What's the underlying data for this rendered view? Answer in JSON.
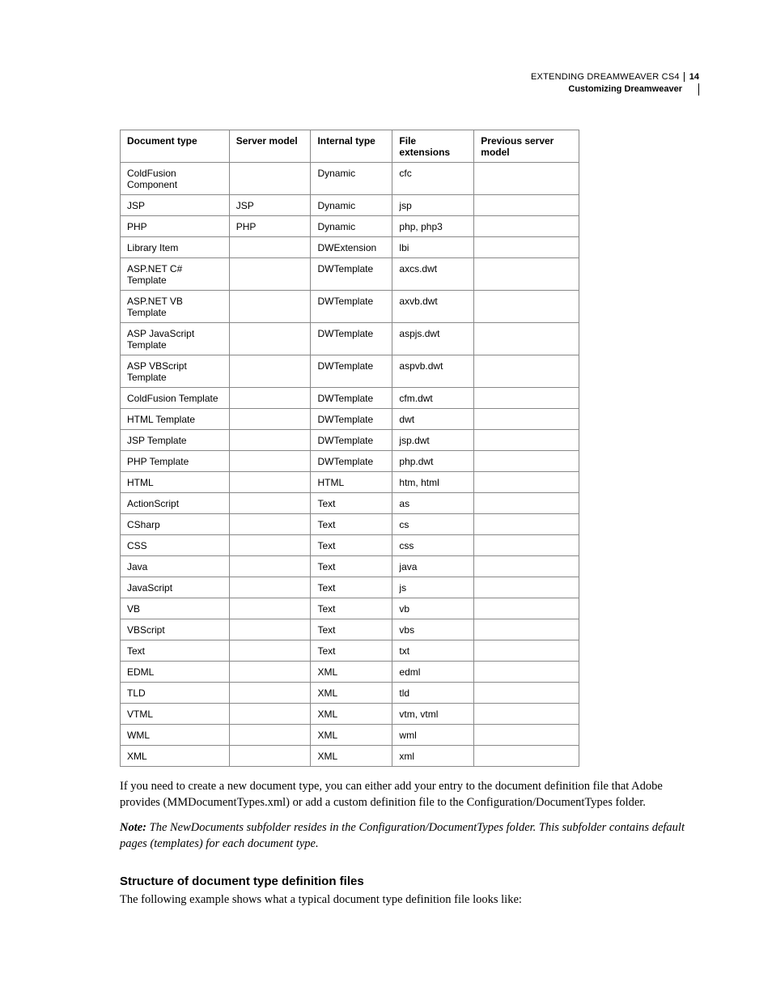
{
  "header": {
    "line1": "EXTENDING DREAMWEAVER CS4",
    "page_number": "14",
    "line2": "Customizing Dreamweaver"
  },
  "table": {
    "headers": [
      "Document type",
      "Server model",
      "Internal type",
      "File extensions",
      "Previous server model"
    ],
    "rows": [
      [
        "ColdFusion Component",
        "",
        "Dynamic",
        "cfc",
        ""
      ],
      [
        "JSP",
        "JSP",
        "Dynamic",
        "jsp",
        ""
      ],
      [
        "PHP",
        "PHP",
        "Dynamic",
        "php, php3",
        ""
      ],
      [
        "Library Item",
        "",
        "DWExtension",
        "lbi",
        ""
      ],
      [
        "ASP.NET C# Template",
        "",
        "DWTemplate",
        "axcs.dwt",
        ""
      ],
      [
        "ASP.NET VB Template",
        "",
        "DWTemplate",
        "axvb.dwt",
        ""
      ],
      [
        "ASP JavaScript Template",
        "",
        "DWTemplate",
        "aspjs.dwt",
        ""
      ],
      [
        "ASP VBScript Template",
        "",
        "DWTemplate",
        "aspvb.dwt",
        ""
      ],
      [
        "ColdFusion Template",
        "",
        "DWTemplate",
        "cfm.dwt",
        ""
      ],
      [
        "HTML Template",
        "",
        "DWTemplate",
        "dwt",
        ""
      ],
      [
        "JSP Template",
        "",
        "DWTemplate",
        "jsp.dwt",
        ""
      ],
      [
        "PHP Template",
        "",
        "DWTemplate",
        "php.dwt",
        ""
      ],
      [
        "HTML",
        "",
        "HTML",
        "htm, html",
        ""
      ],
      [
        "ActionScript",
        "",
        "Text",
        "as",
        ""
      ],
      [
        "CSharp",
        "",
        "Text",
        "cs",
        ""
      ],
      [
        "CSS",
        "",
        "Text",
        "css",
        ""
      ],
      [
        "Java",
        "",
        "Text",
        "java",
        ""
      ],
      [
        "JavaScript",
        "",
        "Text",
        "js",
        ""
      ],
      [
        "VB",
        "",
        "Text",
        "vb",
        ""
      ],
      [
        "VBScript",
        "",
        "Text",
        "vbs",
        ""
      ],
      [
        "Text",
        "",
        "Text",
        "txt",
        ""
      ],
      [
        "EDML",
        "",
        "XML",
        "edml",
        ""
      ],
      [
        "TLD",
        "",
        "XML",
        "tld",
        ""
      ],
      [
        "VTML",
        "",
        "XML",
        "vtm, vtml",
        ""
      ],
      [
        "WML",
        "",
        "XML",
        "wml",
        ""
      ],
      [
        "XML",
        "",
        "XML",
        "xml",
        ""
      ]
    ]
  },
  "para1": "If you need to create a new document type, you can either add your entry to the document definition file that Adobe provides (MMDocumentTypes.xml) or add a custom definition file to the Configuration/DocumentTypes folder.",
  "note_label": "Note:",
  "note_body": " The NewDocuments subfolder resides in the Configuration/DocumentTypes folder. This subfolder contains default pages (templates) for each document type.",
  "heading": "Structure of document type definition files",
  "para2": "The following example shows what a typical document type definition file looks like:"
}
